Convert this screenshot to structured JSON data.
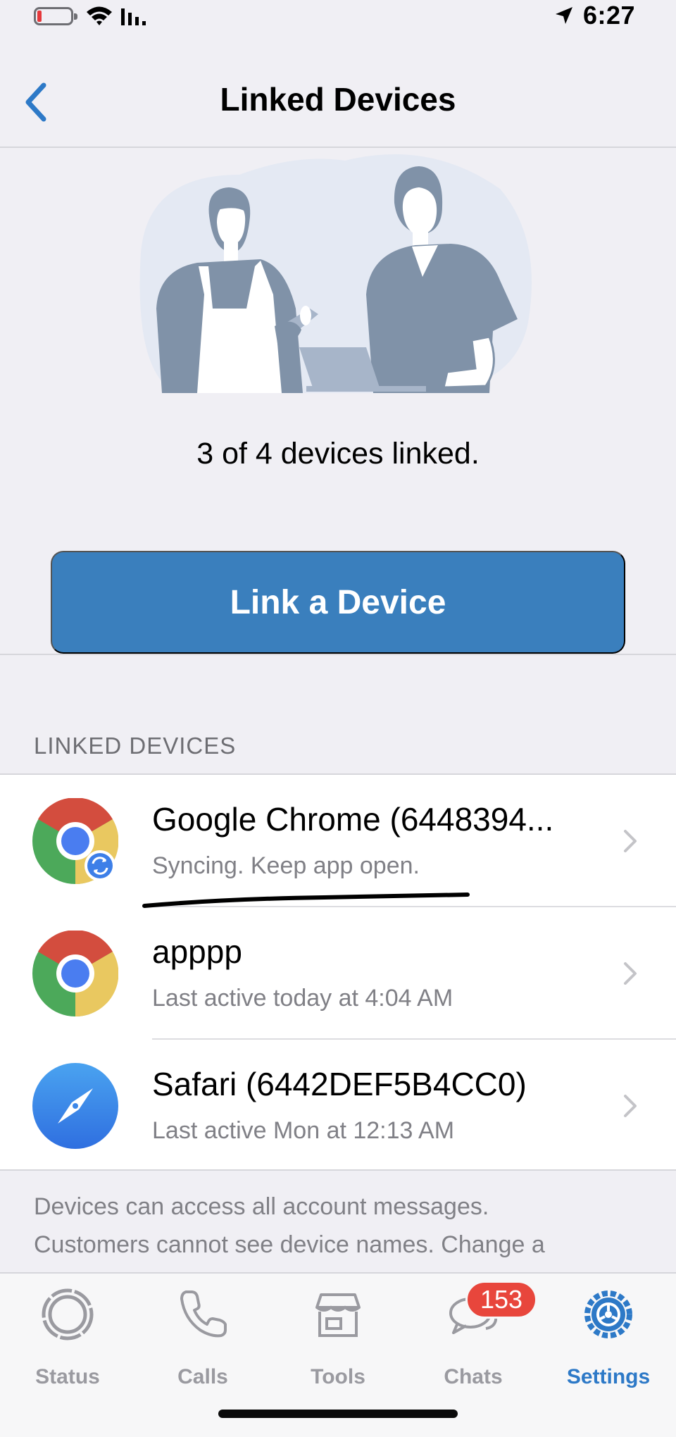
{
  "status_bar": {
    "time": "6:27"
  },
  "nav": {
    "title": "Linked Devices",
    "back_icon": "chevron-left-icon"
  },
  "hero": {
    "devices_count_text": "3 of 4 devices linked."
  },
  "link_button": {
    "label": "Link a Device"
  },
  "linked_devices": {
    "header": "LINKED DEVICES",
    "items": [
      {
        "name": "Google Chrome (6448394...",
        "status": "Syncing. Keep app open.",
        "icon": "chrome-sync-icon"
      },
      {
        "name": "apppp",
        "status": "Last active today at 4:04 AM",
        "icon": "chrome-icon"
      },
      {
        "name": "Safari (6442DEF5B4CC0)",
        "status": "Last active Mon at 12:13 AM",
        "icon": "safari-icon"
      }
    ]
  },
  "footer": {
    "line1": "Devices can access all account messages.",
    "line2": "Customers cannot see device names. Change a"
  },
  "tab_bar": {
    "tabs": [
      {
        "label": "Status",
        "icon": "status-ring-icon"
      },
      {
        "label": "Calls",
        "icon": "phone-icon"
      },
      {
        "label": "Tools",
        "icon": "storefront-icon"
      },
      {
        "label": "Chats",
        "icon": "chat-bubbles-icon"
      },
      {
        "label": "Settings",
        "icon": "gear-icon"
      }
    ],
    "chats_badge": "153",
    "active_tab": "Settings"
  },
  "colors": {
    "accent": "#3a7fbd",
    "active_tab": "#2d79c7",
    "badge": "#e8463c",
    "background": "#f0eff4"
  }
}
